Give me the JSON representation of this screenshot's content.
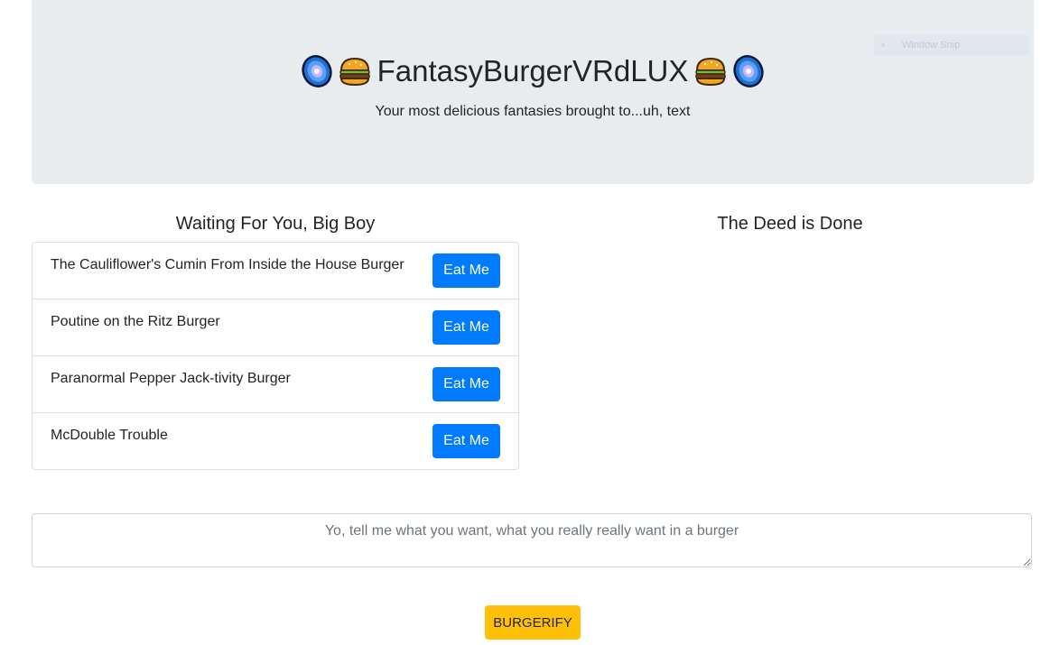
{
  "header": {
    "title": "FantasyBurgerVRdLUX",
    "subtitle": "Your most delicious fantasies brought to...uh, text",
    "left_icons": [
      "galaxy-icon",
      "burger-icon"
    ],
    "right_icons": [
      "burger-icon",
      "galaxy-icon"
    ]
  },
  "overlay": {
    "window_snip_label": "Window Snip",
    "close_glyph": "×"
  },
  "waiting": {
    "heading": "Waiting For You, Big Boy",
    "button_label": "Eat Me",
    "items": [
      {
        "name": "The Cauliflower's Cumin From Inside the House Burger"
      },
      {
        "name": "Poutine on the Ritz Burger"
      },
      {
        "name": "Paranormal Pepper Jack-tivity Burger"
      },
      {
        "name": "McDouble Trouble"
      }
    ]
  },
  "devoured": {
    "heading": "The Deed is Done",
    "items": []
  },
  "form": {
    "placeholder": "Yo, tell me what you want, what you really really want in a burger",
    "value": "",
    "submit_label": "BURGERIFY"
  },
  "colors": {
    "jumbotron_bg": "#e9ecef",
    "primary_button": "#007bff",
    "warning_button": "#ffc107"
  }
}
